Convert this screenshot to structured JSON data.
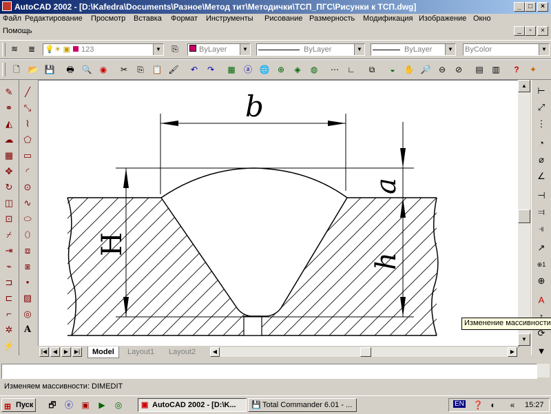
{
  "window": {
    "title": "AutoCAD 2002 - [D:\\Kafedra\\Documents\\Разное\\Метод тит\\Методички\\ТСП_ПГС\\Рисунки к ТСП.dwg]",
    "minimize": "_",
    "maximize": "□",
    "close": "×"
  },
  "menu": [
    "Файл",
    "Редактирование",
    "Просмотр",
    "Вставка",
    "Формат",
    "Инструменты",
    "Рисование",
    "Размерность",
    "Модификация",
    "Изображение",
    "Окно"
  ],
  "menu_row2": "Помощь",
  "layer_toolbar": {
    "layer_value": "123",
    "color_value": "ByLayer",
    "linetype_value": "ByLayer",
    "lineweight_value": "ByLayer",
    "plotstyle_value": "ByColor",
    "accent_colors": {
      "layer_swatch": "#cc0066"
    }
  },
  "drawing": {
    "label_b": "b",
    "label_a": "a",
    "label_H": "H",
    "label_h": "h"
  },
  "tabs": {
    "model": "Model",
    "layout1": "Layout1",
    "layout2": "Layout2"
  },
  "tooltip": "Изменение массивности",
  "command": {
    "line1": "",
    "line2": "Изменяем массивности: DIMEDIT"
  },
  "taskbar": {
    "start": "Пуск",
    "task1": "AutoCAD 2002 - [D:\\K...",
    "task2": "Total Commander 6.01 - ...",
    "lang": "EN",
    "clock": "15:27"
  }
}
